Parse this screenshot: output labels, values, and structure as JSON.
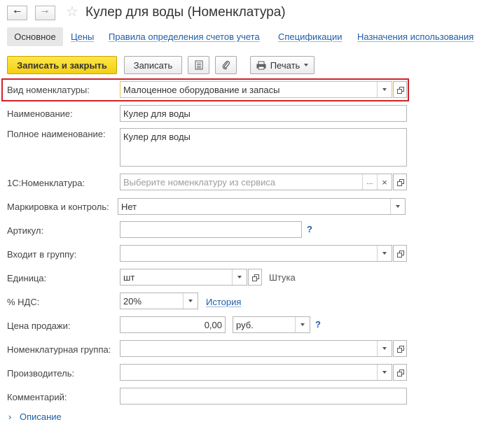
{
  "header": {
    "back_icon": "arrow-left-icon",
    "forward_icon": "arrow-right-icon",
    "favorite_icon": "star-icon",
    "title": "Кулер для воды (Номенклатура)"
  },
  "tabs": [
    {
      "label": "Основное",
      "active": true
    },
    {
      "label": "Цены"
    },
    {
      "label": "Правила определения счетов учета"
    },
    {
      "label": "Спецификации"
    },
    {
      "label": "Назначения использования"
    }
  ],
  "toolbar": {
    "save_close_label": "Записать и закрыть",
    "save_label": "Записать",
    "list_icon": "document-list-icon",
    "attach_icon": "paperclip-icon",
    "print_label": "Печать",
    "print_icon": "printer-icon"
  },
  "colors": {
    "accent_yellow": "#f4cf12",
    "link_blue": "#1f5fa8",
    "highlight_red": "#d0232a"
  },
  "form": {
    "kind": {
      "label": "Вид номенклатуры:",
      "value": "Малоценное оборудование и запасы"
    },
    "name": {
      "label": "Наименование:",
      "value": "Кулер для воды"
    },
    "full_name": {
      "label": "Полное наименование:",
      "value": "Кулер для воды"
    },
    "c1": {
      "label": "1С:Номенклатура:",
      "placeholder": "Выберите номенклатуру из сервиса",
      "ellipsis": "...",
      "clear": "×"
    },
    "marking": {
      "label": "Маркировка и контроль:",
      "value": "Нет"
    },
    "article": {
      "label": "Артикул:",
      "value": "",
      "help": "?"
    },
    "group": {
      "label": "Входит в группу:",
      "value": ""
    },
    "unit": {
      "label": "Единица:",
      "value": "шт",
      "unit_name": "Штука"
    },
    "vat": {
      "label": "% НДС:",
      "value": "20%",
      "history_link": "История"
    },
    "price": {
      "label": "Цена продажи:",
      "value": "0,00",
      "currency": "руб.",
      "help": "?"
    },
    "nomen_group": {
      "label": "Номенклатурная группа:",
      "value": ""
    },
    "manufacturer": {
      "label": "Производитель:",
      "value": ""
    },
    "comment": {
      "label": "Комментарий:",
      "value": ""
    },
    "description_link": "Описание"
  }
}
